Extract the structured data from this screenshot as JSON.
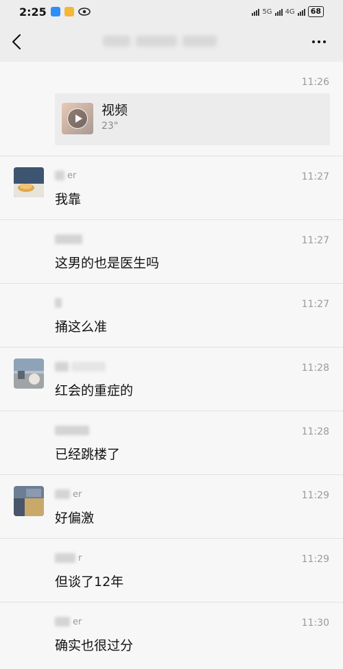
{
  "status_bar": {
    "time": "2:25",
    "network": "5G",
    "network2": "4G",
    "battery": "68"
  },
  "header": {
    "back_icon": "chevron-left-icon",
    "more_icon": "more-dots-icon"
  },
  "video_message": {
    "time": "11:26",
    "title": "视频",
    "duration": "23\""
  },
  "messages": [
    {
      "sender": "er",
      "time": "11:27",
      "text": "我靠",
      "avatar": "photo-bread"
    },
    {
      "sender": "",
      "time": "11:27",
      "text": "这男的也是医生吗",
      "avatar": ""
    },
    {
      "sender": "",
      "time": "11:27",
      "text": "捅这么准",
      "avatar": ""
    },
    {
      "sender": "",
      "time": "11:28",
      "text": "红会的重症的",
      "avatar": "photo-street"
    },
    {
      "sender": "",
      "time": "11:28",
      "text": "已经跳楼了",
      "avatar": ""
    },
    {
      "sender": "er",
      "time": "11:29",
      "text": "好偏激",
      "avatar": "photo-building"
    },
    {
      "sender": "r",
      "time": "11:29",
      "text": "但谈了12年",
      "avatar": ""
    },
    {
      "sender": "er",
      "time": "11:30",
      "text": "确实也很过分",
      "avatar": ""
    }
  ]
}
